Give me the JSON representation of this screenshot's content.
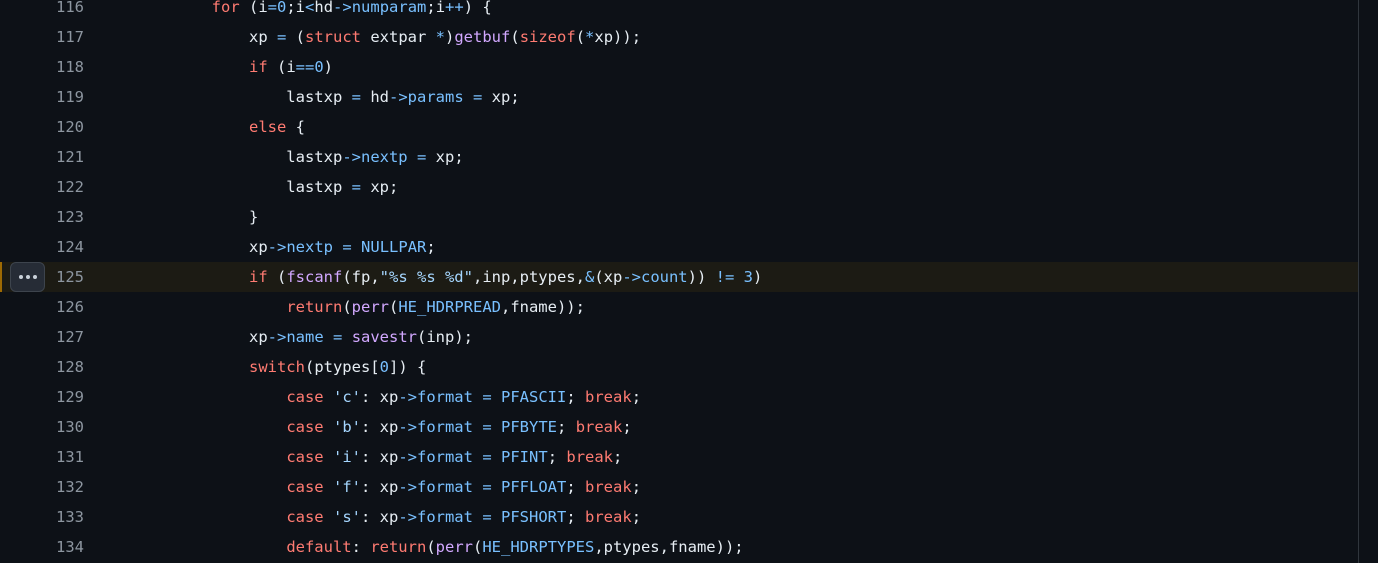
{
  "lines": [
    {
      "n": "116",
      "tokens": [
        [
          "tx",
          "        "
        ],
        [
          "kw",
          "for"
        ],
        [
          "tx",
          " (i"
        ],
        [
          "op",
          "="
        ],
        [
          "c",
          "0"
        ],
        [
          "tx",
          ";i"
        ],
        [
          "op",
          "<"
        ],
        [
          "tx",
          "hd"
        ],
        [
          "op",
          "->"
        ],
        [
          "c",
          "numparam"
        ],
        [
          "tx",
          ";i"
        ],
        [
          "op",
          "++"
        ],
        [
          "tx",
          ") {"
        ]
      ]
    },
    {
      "n": "117",
      "tokens": [
        [
          "tx",
          "            xp "
        ],
        [
          "op",
          "="
        ],
        [
          "tx",
          " ("
        ],
        [
          "kw",
          "struct"
        ],
        [
          "tx",
          " extpar "
        ],
        [
          "op",
          "*"
        ],
        [
          "tx",
          ")"
        ],
        [
          "fn",
          "getbuf"
        ],
        [
          "tx",
          "("
        ],
        [
          "kw",
          "sizeof"
        ],
        [
          "tx",
          "("
        ],
        [
          "op",
          "*"
        ],
        [
          "tx",
          "xp));"
        ]
      ]
    },
    {
      "n": "118",
      "tokens": [
        [
          "tx",
          "            "
        ],
        [
          "kw",
          "if"
        ],
        [
          "tx",
          " (i"
        ],
        [
          "op",
          "=="
        ],
        [
          "c",
          "0"
        ],
        [
          "tx",
          ")"
        ]
      ]
    },
    {
      "n": "119",
      "tokens": [
        [
          "tx",
          "                lastxp "
        ],
        [
          "op",
          "="
        ],
        [
          "tx",
          " hd"
        ],
        [
          "op",
          "->"
        ],
        [
          "c",
          "params"
        ],
        [
          "tx",
          " "
        ],
        [
          "op",
          "="
        ],
        [
          "tx",
          " xp;"
        ]
      ]
    },
    {
      "n": "120",
      "tokens": [
        [
          "tx",
          "            "
        ],
        [
          "kw",
          "else"
        ],
        [
          "tx",
          " {"
        ]
      ]
    },
    {
      "n": "121",
      "tokens": [
        [
          "tx",
          "                lastxp"
        ],
        [
          "op",
          "->"
        ],
        [
          "c",
          "nextp"
        ],
        [
          "tx",
          " "
        ],
        [
          "op",
          "="
        ],
        [
          "tx",
          " xp;"
        ]
      ]
    },
    {
      "n": "122",
      "tokens": [
        [
          "tx",
          "                lastxp "
        ],
        [
          "op",
          "="
        ],
        [
          "tx",
          " xp;"
        ]
      ]
    },
    {
      "n": "123",
      "tokens": [
        [
          "tx",
          "            }"
        ]
      ]
    },
    {
      "n": "124",
      "tokens": [
        [
          "tx",
          "            xp"
        ],
        [
          "op",
          "->"
        ],
        [
          "c",
          "nextp"
        ],
        [
          "tx",
          " "
        ],
        [
          "op",
          "="
        ],
        [
          "tx",
          " "
        ],
        [
          "c",
          "NULLPAR"
        ],
        [
          "tx",
          ";"
        ]
      ]
    },
    {
      "n": "125",
      "tokens": [
        [
          "tx",
          "            "
        ],
        [
          "kw",
          "if"
        ],
        [
          "tx",
          " ("
        ],
        [
          "fn",
          "fscanf"
        ],
        [
          "tx",
          "(fp,"
        ],
        [
          "s",
          "\"%s %s %d\""
        ],
        [
          "tx",
          ",inp,ptypes,"
        ],
        [
          "op",
          "&"
        ],
        [
          "tx",
          "(xp"
        ],
        [
          "op",
          "->"
        ],
        [
          "c",
          "count"
        ],
        [
          "tx",
          ")) "
        ],
        [
          "op",
          "!="
        ],
        [
          "tx",
          " "
        ],
        [
          "c",
          "3"
        ],
        [
          "tx",
          ")"
        ]
      ]
    },
    {
      "n": "126",
      "tokens": [
        [
          "tx",
          "                "
        ],
        [
          "kw",
          "return"
        ],
        [
          "tx",
          "("
        ],
        [
          "fn",
          "perr"
        ],
        [
          "tx",
          "("
        ],
        [
          "c",
          "HE_HDRPREAD"
        ],
        [
          "tx",
          ",fname));"
        ]
      ]
    },
    {
      "n": "127",
      "tokens": [
        [
          "tx",
          "            xp"
        ],
        [
          "op",
          "->"
        ],
        [
          "c",
          "name"
        ],
        [
          "tx",
          " "
        ],
        [
          "op",
          "="
        ],
        [
          "tx",
          " "
        ],
        [
          "fn",
          "savestr"
        ],
        [
          "tx",
          "(inp);"
        ]
      ]
    },
    {
      "n": "128",
      "tokens": [
        [
          "tx",
          "            "
        ],
        [
          "kw",
          "switch"
        ],
        [
          "tx",
          "(ptypes["
        ],
        [
          "c",
          "0"
        ],
        [
          "tx",
          "]) {"
        ]
      ]
    },
    {
      "n": "129",
      "tokens": [
        [
          "tx",
          "                "
        ],
        [
          "kw",
          "case"
        ],
        [
          "tx",
          " "
        ],
        [
          "s",
          "'c'"
        ],
        [
          "tx",
          ": xp"
        ],
        [
          "op",
          "->"
        ],
        [
          "c",
          "format"
        ],
        [
          "tx",
          " "
        ],
        [
          "op",
          "="
        ],
        [
          "tx",
          " "
        ],
        [
          "c",
          "PFASCII"
        ],
        [
          "tx",
          "; "
        ],
        [
          "kw",
          "break"
        ],
        [
          "tx",
          ";"
        ]
      ]
    },
    {
      "n": "130",
      "tokens": [
        [
          "tx",
          "                "
        ],
        [
          "kw",
          "case"
        ],
        [
          "tx",
          " "
        ],
        [
          "s",
          "'b'"
        ],
        [
          "tx",
          ": xp"
        ],
        [
          "op",
          "->"
        ],
        [
          "c",
          "format"
        ],
        [
          "tx",
          " "
        ],
        [
          "op",
          "="
        ],
        [
          "tx",
          " "
        ],
        [
          "c",
          "PFBYTE"
        ],
        [
          "tx",
          "; "
        ],
        [
          "kw",
          "break"
        ],
        [
          "tx",
          ";"
        ]
      ]
    },
    {
      "n": "131",
      "tokens": [
        [
          "tx",
          "                "
        ],
        [
          "kw",
          "case"
        ],
        [
          "tx",
          " "
        ],
        [
          "s",
          "'i'"
        ],
        [
          "tx",
          ": xp"
        ],
        [
          "op",
          "->"
        ],
        [
          "c",
          "format"
        ],
        [
          "tx",
          " "
        ],
        [
          "op",
          "="
        ],
        [
          "tx",
          " "
        ],
        [
          "c",
          "PFINT"
        ],
        [
          "tx",
          "; "
        ],
        [
          "kw",
          "break"
        ],
        [
          "tx",
          ";"
        ]
      ]
    },
    {
      "n": "132",
      "tokens": [
        [
          "tx",
          "                "
        ],
        [
          "kw",
          "case"
        ],
        [
          "tx",
          " "
        ],
        [
          "s",
          "'f'"
        ],
        [
          "tx",
          ": xp"
        ],
        [
          "op",
          "->"
        ],
        [
          "c",
          "format"
        ],
        [
          "tx",
          " "
        ],
        [
          "op",
          "="
        ],
        [
          "tx",
          " "
        ],
        [
          "c",
          "PFFLOAT"
        ],
        [
          "tx",
          "; "
        ],
        [
          "kw",
          "break"
        ],
        [
          "tx",
          ";"
        ]
      ]
    },
    {
      "n": "133",
      "tokens": [
        [
          "tx",
          "                "
        ],
        [
          "kw",
          "case"
        ],
        [
          "tx",
          " "
        ],
        [
          "s",
          "'s'"
        ],
        [
          "tx",
          ": xp"
        ],
        [
          "op",
          "->"
        ],
        [
          "c",
          "format"
        ],
        [
          "tx",
          " "
        ],
        [
          "op",
          "="
        ],
        [
          "tx",
          " "
        ],
        [
          "c",
          "PFSHORT"
        ],
        [
          "tx",
          "; "
        ],
        [
          "kw",
          "break"
        ],
        [
          "tx",
          ";"
        ]
      ]
    },
    {
      "n": "134",
      "tokens": [
        [
          "tx",
          "                "
        ],
        [
          "kw",
          "default"
        ],
        [
          "tx",
          ": "
        ],
        [
          "kw",
          "return"
        ],
        [
          "tx",
          "("
        ],
        [
          "fn",
          "perr"
        ],
        [
          "tx",
          "("
        ],
        [
          "c",
          "HE_HDRPTYPES"
        ],
        [
          "tx",
          ",ptypes,fname));"
        ]
      ]
    }
  ],
  "highlighted_line": "125",
  "colors": {
    "background": "#0d1117",
    "keyword": "#ff7b72",
    "function": "#d2a8ff",
    "constant": "#79c0ff",
    "string": "#a5d6ff",
    "line_number": "#8d96a0",
    "highlight_bg": "#1c1b14"
  },
  "icons": {
    "line_options": "kebab-horizontal-icon"
  }
}
